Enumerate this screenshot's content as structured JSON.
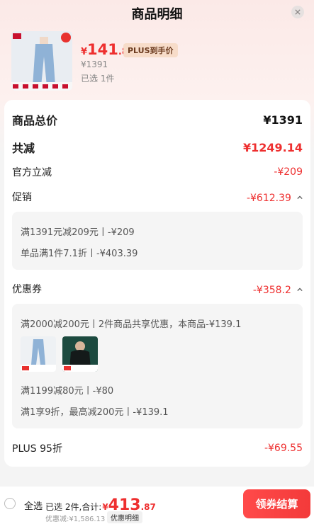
{
  "header": {
    "title": "商品明细"
  },
  "product": {
    "price_yen": "¥",
    "price_int": "141",
    "price_dec": ".86",
    "plus_tag": "PLUS到手价",
    "original_price": "¥1391",
    "selected": "已选 1件"
  },
  "summary": {
    "total_label": "商品总价",
    "total_value": "¥1391",
    "reduce_label": "共减",
    "reduce_value": "¥1249.14",
    "official_label": "官方立减",
    "official_value": "-¥209",
    "promo_label": "促销",
    "promo_value": "-¥612.39",
    "promo_details": [
      "满1391元减209元丨-¥209",
      "单品满1件7.1折丨-¥403.39"
    ],
    "coupon_label": "优惠券",
    "coupon_value": "-¥358.2",
    "coupon_details": {
      "line1": "满2000减200元丨2件商品共享优惠，本商品-¥139.1",
      "line2": "满1199减80元丨-¥80",
      "line3": "满1享9折，最高减200元丨-¥139.1"
    },
    "plus_label": "PLUS 95折",
    "plus_value": "-¥69.55"
  },
  "footer": {
    "select_all": "全选",
    "selected_count": "已选 2件,合计:",
    "total_yen": "¥",
    "total_int": "413",
    "total_dec": ".87",
    "discount_text": "优惠减:¥1,586.13",
    "detail_button": "优惠明细",
    "checkout_button": "领券结算"
  },
  "colors": {
    "accent": "#ee2f2f",
    "button": "#f33a3a"
  }
}
